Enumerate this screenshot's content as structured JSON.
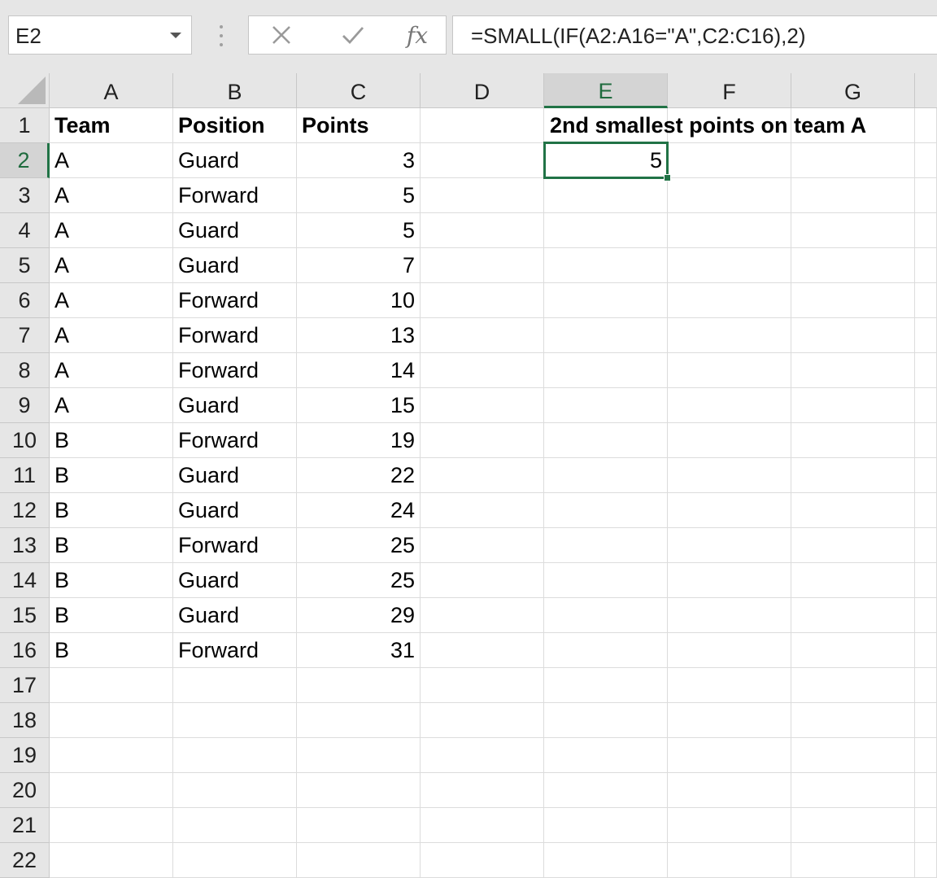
{
  "formula_bar": {
    "name_box": "E2",
    "formula": "=SMALL(IF(A2:A16=\"A\",C2:C16),2)",
    "fx_label": "fx"
  },
  "columns": [
    "A",
    "B",
    "C",
    "D",
    "E",
    "F",
    "G"
  ],
  "active_column": "E",
  "active_row": 2,
  "rows": [
    "1",
    "2",
    "3",
    "4",
    "5",
    "6",
    "7",
    "8",
    "9",
    "10",
    "11",
    "12",
    "13",
    "14",
    "15",
    "16",
    "17",
    "18",
    "19",
    "20",
    "21",
    "22"
  ],
  "headers": {
    "team": "Team",
    "position": "Position",
    "points": "Points"
  },
  "data": [
    {
      "team": "A",
      "position": "Guard",
      "points": "3"
    },
    {
      "team": "A",
      "position": "Forward",
      "points": "5"
    },
    {
      "team": "A",
      "position": "Guard",
      "points": "5"
    },
    {
      "team": "A",
      "position": "Guard",
      "points": "7"
    },
    {
      "team": "A",
      "position": "Forward",
      "points": "10"
    },
    {
      "team": "A",
      "position": "Forward",
      "points": "13"
    },
    {
      "team": "A",
      "position": "Forward",
      "points": "14"
    },
    {
      "team": "A",
      "position": "Guard",
      "points": "15"
    },
    {
      "team": "B",
      "position": "Forward",
      "points": "19"
    },
    {
      "team": "B",
      "position": "Guard",
      "points": "22"
    },
    {
      "team": "B",
      "position": "Guard",
      "points": "24"
    },
    {
      "team": "B",
      "position": "Forward",
      "points": "25"
    },
    {
      "team": "B",
      "position": "Guard",
      "points": "25"
    },
    {
      "team": "B",
      "position": "Guard",
      "points": "29"
    },
    {
      "team": "B",
      "position": "Forward",
      "points": "31"
    }
  ],
  "result": {
    "label": "2nd smallest points on team A",
    "value": "5"
  },
  "colors": {
    "accent": "#217346",
    "header_bg": "#e6e6e6",
    "gridline": "#dcdcdc"
  },
  "icons": {
    "cancel": "close-icon",
    "enter": "check-icon",
    "fx": "function-icon",
    "namebox": "chevron-down-icon"
  }
}
